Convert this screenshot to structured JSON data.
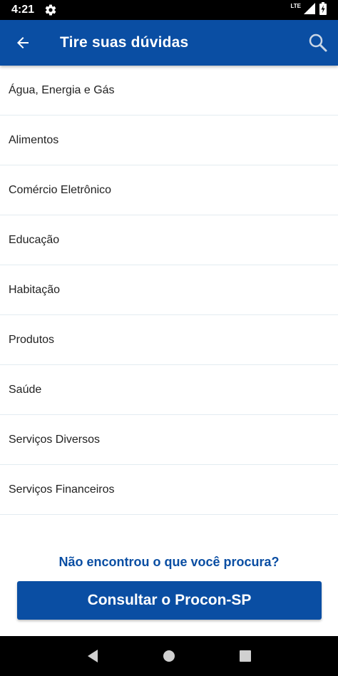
{
  "status_bar": {
    "time": "4:21",
    "network_label": "LTE",
    "icons": [
      "settings-gear-icon",
      "signal-icon",
      "battery-icon"
    ]
  },
  "app_bar": {
    "title": "Tire suas dúvidas",
    "back_icon": "arrow-left-icon",
    "search_icon": "search-icon"
  },
  "topics": [
    "Água, Energia e Gás",
    "Alimentos",
    "Comércio Eletrônico",
    "Educação",
    "Habitação",
    "Produtos",
    "Saúde",
    "Serviços Diversos",
    "Serviços Financeiros"
  ],
  "footer": {
    "question": "Não encontrou o que você procura?",
    "button_label": "Consultar o Procon-SP"
  },
  "nav_bar": {
    "icons": [
      "back-triangle-icon",
      "home-circle-icon",
      "recents-square-icon"
    ]
  },
  "colors": {
    "primary": "#0a4ea3",
    "divider": "#e3ecf1",
    "text": "#222222"
  }
}
